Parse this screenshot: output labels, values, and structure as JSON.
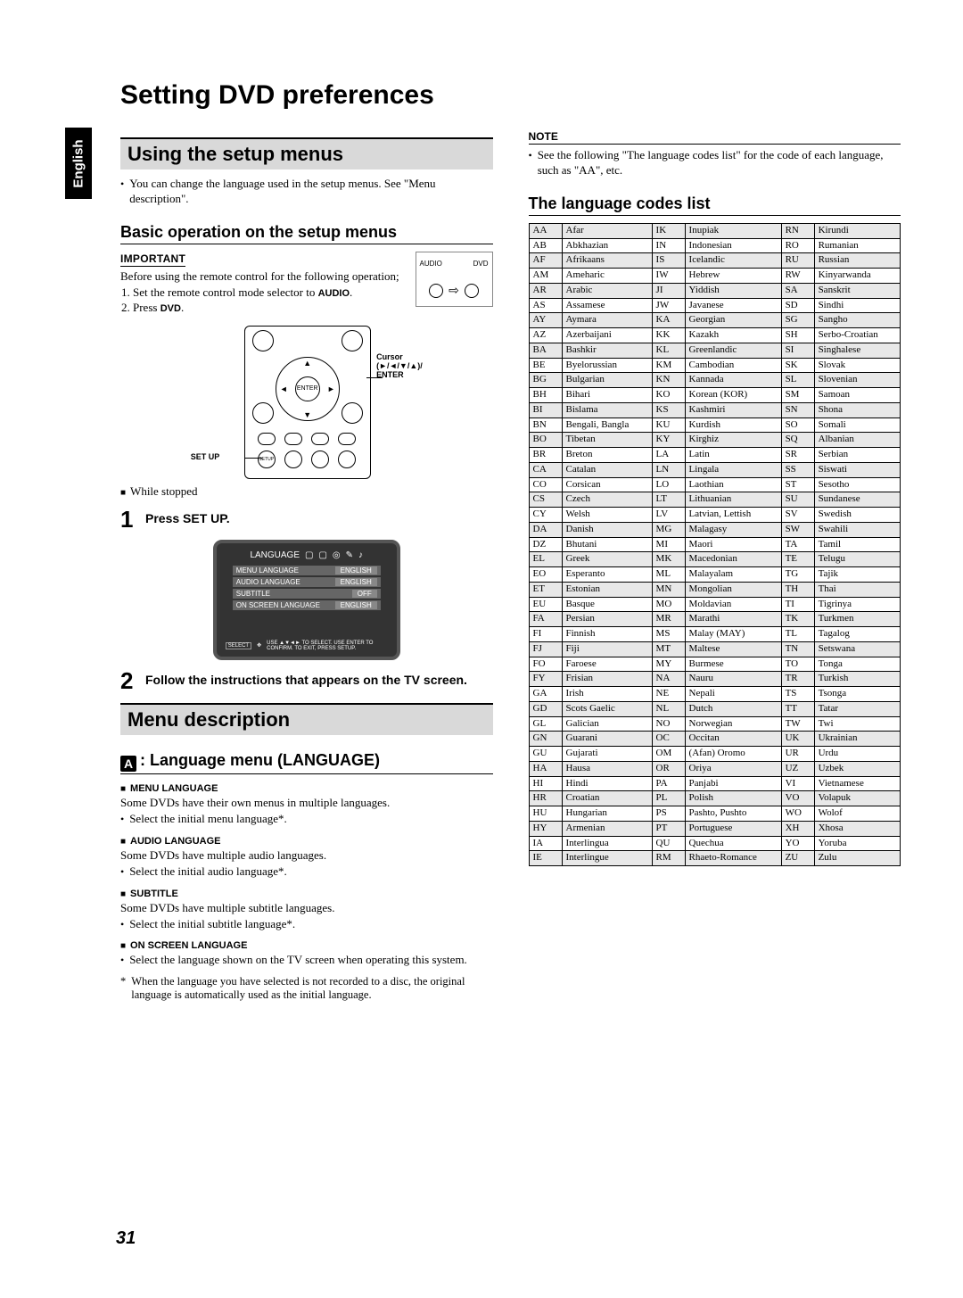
{
  "lang_tab": "English",
  "h1": "Setting DVD preferences",
  "col1": {
    "using_heading": "Using the setup menus",
    "using_bullet": "You can change the language used in the setup menus. See \"Menu description\".",
    "basic_heading": "Basic operation on the setup menus",
    "important_label": "IMPORTANT",
    "important_intro": "Before using the remote control for the following operation;",
    "important_steps": [
      "Set the remote control mode selector to AUDIO.",
      "Press DVD."
    ],
    "selector_labels": {
      "audio": "AUDIO",
      "dvd": "DVD"
    },
    "remote_labels": {
      "cursor": "Cursor",
      "arrows": "(►/◄/▼/▲)/",
      "enter": "ENTER",
      "enter_btn": "ENTER",
      "setup": "SET UP",
      "setup_btn": "SETUP"
    },
    "while_stopped": "While stopped",
    "step1_num": "1",
    "step1_text": "Press SET UP.",
    "tv": {
      "tab": "LANGUAGE",
      "rows": [
        [
          "MENU LANGUAGE",
          "ENGLISH"
        ],
        [
          "AUDIO LANGUAGE",
          "ENGLISH"
        ],
        [
          "SUBTITLE",
          "OFF"
        ],
        [
          "ON SCREEN LANGUAGE",
          "ENGLISH"
        ]
      ],
      "foot_select": "SELECT",
      "foot_enter": "ENTER",
      "foot_hint": "USE ▲▼◄► TO SELECT. USE ENTER TO CONFIRM. TO EXIT, PRESS SETUP."
    },
    "step2_num": "2",
    "step2_text": "Follow the instructions that appears on the TV screen.",
    "menu_desc_heading": "Menu description",
    "lang_menu_heading": ": Language menu (LANGUAGE)",
    "sections": {
      "menu_lang": {
        "title": "MENU LANGUAGE",
        "desc": "Some DVDs have their own menus in multiple languages.",
        "bullet": "Select the initial menu language*."
      },
      "audio_lang": {
        "title": "AUDIO LANGUAGE",
        "desc": "Some DVDs have multiple audio languages.",
        "bullet": "Select the initial audio language*."
      },
      "subtitle": {
        "title": "SUBTITLE",
        "desc": "Some DVDs have multiple subtitle languages.",
        "bullet": "Select the initial subtitle language*."
      },
      "osd": {
        "title": "ON SCREEN LANGUAGE",
        "bullet": "Select the language shown on the TV screen when operating this system."
      }
    },
    "footnote_marker": "*",
    "footnote_text": "When the language you have selected is not recorded to a disc, the original language is automatically used as the initial language."
  },
  "col2": {
    "note_label": "NOTE",
    "note_text": "See the following \"The language codes list\" for the code of each language, such as \"AA\", etc.",
    "codes_heading": "The language codes list",
    "codes_c1": [
      [
        "AA",
        "Afar"
      ],
      [
        "AB",
        "Abkhazian"
      ],
      [
        "AF",
        "Afrikaans"
      ],
      [
        "AM",
        "Ameharic"
      ],
      [
        "AR",
        "Arabic"
      ],
      [
        "AS",
        "Assamese"
      ],
      [
        "AY",
        "Aymara"
      ],
      [
        "AZ",
        "Azerbaijani"
      ],
      [
        "BA",
        "Bashkir"
      ],
      [
        "BE",
        "Byelorussian"
      ],
      [
        "BG",
        "Bulgarian"
      ],
      [
        "BH",
        "Bihari"
      ],
      [
        "BI",
        "Bislama"
      ],
      [
        "BN",
        "Bengali, Bangla"
      ],
      [
        "BO",
        "Tibetan"
      ],
      [
        "BR",
        "Breton"
      ],
      [
        "CA",
        "Catalan"
      ],
      [
        "CO",
        "Corsican"
      ],
      [
        "CS",
        "Czech"
      ],
      [
        "CY",
        "Welsh"
      ],
      [
        "DA",
        "Danish"
      ],
      [
        "DZ",
        "Bhutani"
      ],
      [
        "EL",
        "Greek"
      ],
      [
        "EO",
        "Esperanto"
      ],
      [
        "ET",
        "Estonian"
      ],
      [
        "EU",
        "Basque"
      ],
      [
        "FA",
        "Persian"
      ],
      [
        "FI",
        "Finnish"
      ],
      [
        "FJ",
        "Fiji"
      ],
      [
        "FO",
        "Faroese"
      ],
      [
        "FY",
        "Frisian"
      ],
      [
        "GA",
        "Irish"
      ],
      [
        "GD",
        "Scots Gaelic"
      ],
      [
        "GL",
        "Galician"
      ],
      [
        "GN",
        "Guarani"
      ],
      [
        "GU",
        "Gujarati"
      ],
      [
        "HA",
        "Hausa"
      ],
      [
        "HI",
        "Hindi"
      ],
      [
        "HR",
        "Croatian"
      ],
      [
        "HU",
        "Hungarian"
      ],
      [
        "HY",
        "Armenian"
      ],
      [
        "IA",
        "Interlingua"
      ],
      [
        "IE",
        "Interlingue"
      ]
    ],
    "codes_c2": [
      [
        "IK",
        "Inupiak"
      ],
      [
        "IN",
        "Indonesian"
      ],
      [
        "IS",
        "Icelandic"
      ],
      [
        "IW",
        "Hebrew"
      ],
      [
        "JI",
        "Yiddish"
      ],
      [
        "JW",
        "Javanese"
      ],
      [
        "KA",
        "Georgian"
      ],
      [
        "KK",
        "Kazakh"
      ],
      [
        "KL",
        "Greenlandic"
      ],
      [
        "KM",
        "Cambodian"
      ],
      [
        "KN",
        "Kannada"
      ],
      [
        "KO",
        "Korean (KOR)"
      ],
      [
        "KS",
        "Kashmiri"
      ],
      [
        "KU",
        "Kurdish"
      ],
      [
        "KY",
        "Kirghiz"
      ],
      [
        "LA",
        "Latin"
      ],
      [
        "LN",
        "Lingala"
      ],
      [
        "LO",
        "Laothian"
      ],
      [
        "LT",
        "Lithuanian"
      ],
      [
        "LV",
        "Latvian, Lettish"
      ],
      [
        "MG",
        "Malagasy"
      ],
      [
        "MI",
        "Maori"
      ],
      [
        "MK",
        "Macedonian"
      ],
      [
        "ML",
        "Malayalam"
      ],
      [
        "MN",
        "Mongolian"
      ],
      [
        "MO",
        "Moldavian"
      ],
      [
        "MR",
        "Marathi"
      ],
      [
        "MS",
        "Malay (MAY)"
      ],
      [
        "MT",
        "Maltese"
      ],
      [
        "MY",
        "Burmese"
      ],
      [
        "NA",
        "Nauru"
      ],
      [
        "NE",
        "Nepali"
      ],
      [
        "NL",
        "Dutch"
      ],
      [
        "NO",
        "Norwegian"
      ],
      [
        "OC",
        "Occitan"
      ],
      [
        "OM",
        "(Afan) Oromo"
      ],
      [
        "OR",
        "Oriya"
      ],
      [
        "PA",
        "Panjabi"
      ],
      [
        "PL",
        "Polish"
      ],
      [
        "PS",
        "Pashto, Pushto"
      ],
      [
        "PT",
        "Portuguese"
      ],
      [
        "QU",
        "Quechua"
      ],
      [
        "RM",
        "Rhaeto-Romance"
      ]
    ],
    "codes_c3": [
      [
        "RN",
        "Kirundi"
      ],
      [
        "RO",
        "Rumanian"
      ],
      [
        "RU",
        "Russian"
      ],
      [
        "RW",
        "Kinyarwanda"
      ],
      [
        "SA",
        "Sanskrit"
      ],
      [
        "SD",
        "Sindhi"
      ],
      [
        "SG",
        "Sangho"
      ],
      [
        "SH",
        "Serbo-Croatian"
      ],
      [
        "SI",
        "Singhalese"
      ],
      [
        "SK",
        "Slovak"
      ],
      [
        "SL",
        "Slovenian"
      ],
      [
        "SM",
        "Samoan"
      ],
      [
        "SN",
        "Shona"
      ],
      [
        "SO",
        "Somali"
      ],
      [
        "SQ",
        "Albanian"
      ],
      [
        "SR",
        "Serbian"
      ],
      [
        "SS",
        "Siswati"
      ],
      [
        "ST",
        "Sesotho"
      ],
      [
        "SU",
        "Sundanese"
      ],
      [
        "SV",
        "Swedish"
      ],
      [
        "SW",
        "Swahili"
      ],
      [
        "TA",
        "Tamil"
      ],
      [
        "TE",
        "Telugu"
      ],
      [
        "TG",
        "Tajik"
      ],
      [
        "TH",
        "Thai"
      ],
      [
        "TI",
        "Tigrinya"
      ],
      [
        "TK",
        "Turkmen"
      ],
      [
        "TL",
        "Tagalog"
      ],
      [
        "TN",
        "Setswana"
      ],
      [
        "TO",
        "Tonga"
      ],
      [
        "TR",
        "Turkish"
      ],
      [
        "TS",
        "Tsonga"
      ],
      [
        "TT",
        "Tatar"
      ],
      [
        "TW",
        "Twi"
      ],
      [
        "UK",
        "Ukrainian"
      ],
      [
        "UR",
        "Urdu"
      ],
      [
        "UZ",
        "Uzbek"
      ],
      [
        "VI",
        "Vietnamese"
      ],
      [
        "VO",
        "Volapuk"
      ],
      [
        "WO",
        "Wolof"
      ],
      [
        "XH",
        "Xhosa"
      ],
      [
        "YO",
        "Yoruba"
      ],
      [
        "ZU",
        "Zulu"
      ]
    ]
  },
  "page_number": "31"
}
